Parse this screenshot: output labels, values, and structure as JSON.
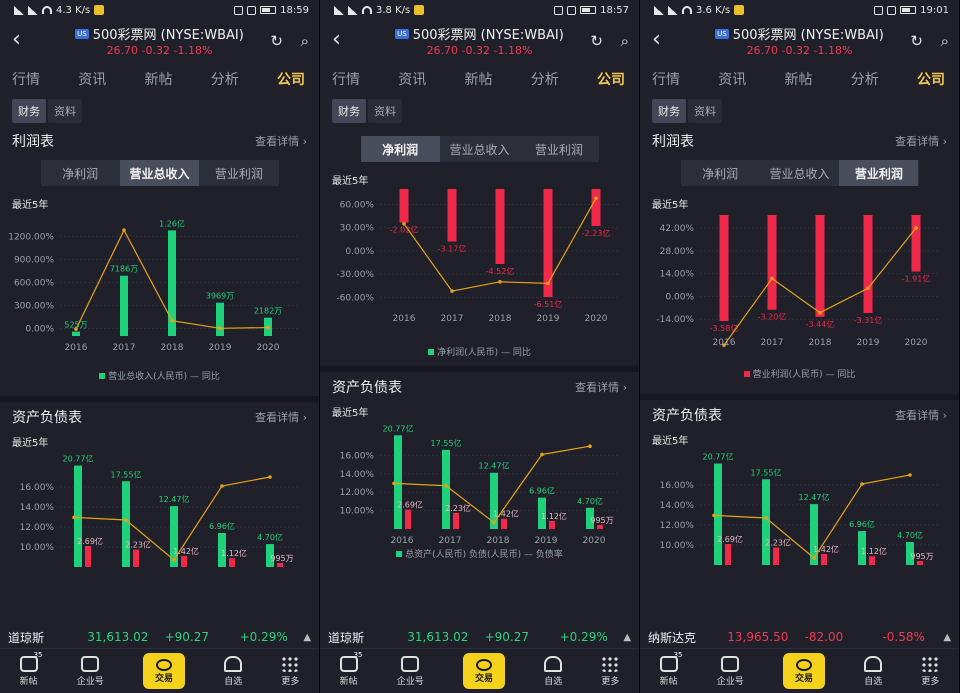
{
  "phones": [
    {
      "status": {
        "left": "4.3 K/s",
        "time": "18:59"
      },
      "title": "500彩票网 (NYSE:WBAI)",
      "us_badge": "US",
      "quote": "26.70  -0.32  -1.18%",
      "tabs": [
        "行情",
        "资讯",
        "新帖",
        "分析",
        "公司"
      ],
      "subtabs": [
        "财务",
        "资料"
      ],
      "profit": {
        "title": "利润表",
        "detail": "查看详情 ›",
        "seg": [
          "净利润",
          "营业总收入",
          "营业利润"
        ],
        "active": 1,
        "range_label": "最近5年",
        "legend": "营业总收入(人民币)  — 同比"
      },
      "balance": {
        "title": "资产负债表",
        "detail": "查看详情 ›",
        "range_label": "最近5年"
      },
      "ticker": {
        "name": "道琼斯",
        "value": "31,613.02",
        "change": "+90.27",
        "pct": "+0.29%",
        "dir": "up"
      }
    },
    {
      "status": {
        "left": "3.8 K/s",
        "time": "18:57"
      },
      "title": "500彩票网 (NYSE:WBAI)",
      "us_badge": "US",
      "quote": "26.70  -0.32  -1.18%",
      "tabs": [
        "行情",
        "资讯",
        "新帖",
        "分析",
        "公司"
      ],
      "subtabs": [
        "财务",
        "资料"
      ],
      "profit": {
        "title": "",
        "detail": "",
        "seg": [
          "净利润",
          "营业总收入",
          "营业利润"
        ],
        "active": 0,
        "range_label": "最近5年",
        "legend": "净利润(人民币)  — 同比"
      },
      "balance": {
        "title": "资产负债表",
        "detail": "查看详情 ›",
        "range_label": "最近5年",
        "legend": "总资产(人民币)   负债(人民币)  — 负债率"
      },
      "ticker": {
        "name": "道琼斯",
        "value": "31,613.02",
        "change": "+90.27",
        "pct": "+0.29%",
        "dir": "up"
      }
    },
    {
      "status": {
        "left": "3.6 K/s",
        "time": "19:01"
      },
      "title": "500彩票网 (NYSE:WBAI)",
      "us_badge": "US",
      "quote": "26.70  -0.32  -1.18%",
      "tabs": [
        "行情",
        "资讯",
        "新帖",
        "分析",
        "公司"
      ],
      "subtabs": [
        "财务",
        "资料"
      ],
      "profit": {
        "title": "利润表",
        "detail": "查看详情 ›",
        "seg": [
          "净利润",
          "营业总收入",
          "营业利润"
        ],
        "active": 2,
        "range_label": "最近5年",
        "legend": "营业利润(人民币)  — 同比"
      },
      "balance": {
        "title": "资产负债表",
        "detail": "查看详情 ›",
        "range_label": "最近5年"
      },
      "ticker": {
        "name": "纳斯达克",
        "value": "13,965.50",
        "change": "-82.00",
        "pct": "-0.58%",
        "dir": "down"
      }
    }
  ],
  "bottom_nav": [
    {
      "label": "新帖",
      "badge": "35"
    },
    {
      "label": "企业号"
    },
    {
      "label": "交易"
    },
    {
      "label": "自选"
    },
    {
      "label": "更多"
    }
  ],
  "colors": {
    "green": "#1fd17a",
    "red": "#f0294a",
    "line": "#e4a318",
    "up": "#2ed47a",
    "down": "#f0394f",
    "accent": "#f2c94c"
  },
  "chart_data": [
    {
      "type": "bar",
      "id": "revenue",
      "categories": [
        "2016",
        "2017",
        "2018",
        "2019",
        "2020"
      ],
      "series": [
        {
          "values": [
            525,
            7186,
            12600,
            3969,
            2182
          ],
          "labels": [
            "525万",
            "7186万",
            "1.26亿",
            "3969万",
            "2182万"
          ],
          "unit": "万",
          "color": "#1fd17a"
        },
        {
          "type": "line",
          "values": [
            -10,
            1280,
            100,
            0,
            10
          ],
          "color": "#e4a318"
        }
      ],
      "ylim": [
        -100,
        1400
      ],
      "yticks": [
        "0.00%",
        "300.00%",
        "600.00%",
        "900.00%",
        "1200.00%"
      ],
      "legend": [
        "营业总收入(人民币)",
        "同比"
      ]
    },
    {
      "type": "bar",
      "id": "net_profit",
      "categories": [
        "2016",
        "2017",
        "2018",
        "2019",
        "2020"
      ],
      "series": [
        {
          "values": [
            -2.02,
            -3.17,
            -4.52,
            -6.51,
            -2.23
          ],
          "labels": [
            "-2.02亿",
            "-3.17亿",
            "-4.52亿",
            "-6.51亿",
            "-2.23亿"
          ],
          "unit": "亿",
          "color": "#f0294a"
        },
        {
          "type": "line",
          "values": [
            35,
            -52,
            -40,
            -42,
            68
          ],
          "color": "#e4a318"
        }
      ],
      "ylim": [
        -70,
        80
      ],
      "yticks": [
        "-60.00%",
        "-30.00%",
        "0.00%",
        "30.00%",
        "60.00%"
      ],
      "legend": [
        "净利润(人民币)",
        "同比"
      ]
    },
    {
      "type": "bar",
      "id": "operating_profit",
      "categories": [
        "2016",
        "2017",
        "2018",
        "2019",
        "2020"
      ],
      "series": [
        {
          "values": [
            -3.58,
            -3.2,
            -3.44,
            -3.31,
            -1.91
          ],
          "labels": [
            "-3.58亿",
            "-3.20亿",
            "-3.44亿",
            "-3.31亿",
            "-1.91亿"
          ],
          "unit": "亿",
          "color": "#f0294a"
        },
        {
          "type": "line",
          "values": [
            -30,
            11,
            -10,
            5,
            42
          ],
          "color": "#e4a318"
        }
      ],
      "ylim": [
        -20,
        50
      ],
      "yticks": [
        "-14.00%",
        "0.00%",
        "14.00%",
        "28.00%",
        "42.00%"
      ],
      "legend": [
        "营业利润(人民币)",
        "同比"
      ]
    },
    {
      "type": "bar",
      "id": "balance",
      "categories": [
        "2016",
        "2017",
        "2018",
        "2019",
        "2020"
      ],
      "series": [
        {
          "name": "总资产(人民币)",
          "values": [
            20.77,
            17.55,
            12.47,
            6.96,
            4.7
          ],
          "labels": [
            "20.77亿",
            "17.55亿",
            "12.47亿",
            "6.96亿",
            "4.70亿"
          ],
          "color": "#1fd17a"
        },
        {
          "name": "负债(人民币)",
          "values": [
            2.69,
            2.23,
            1.42,
            1.12,
            0.0995
          ],
          "labels": [
            "2.69亿",
            "2.23亿",
            "1.42亿",
            "1.12亿",
            "995万"
          ],
          "color": "#f0294a"
        },
        {
          "name": "负债率",
          "type": "line",
          "values": [
            12.96,
            12.7,
            8.7,
            16.1,
            17.0
          ],
          "color": "#e4a318"
        }
      ],
      "ylim": [
        8,
        18
      ],
      "yticks": [
        "10.00%",
        "12.00%",
        "14.00%",
        "16.00%"
      ]
    }
  ]
}
